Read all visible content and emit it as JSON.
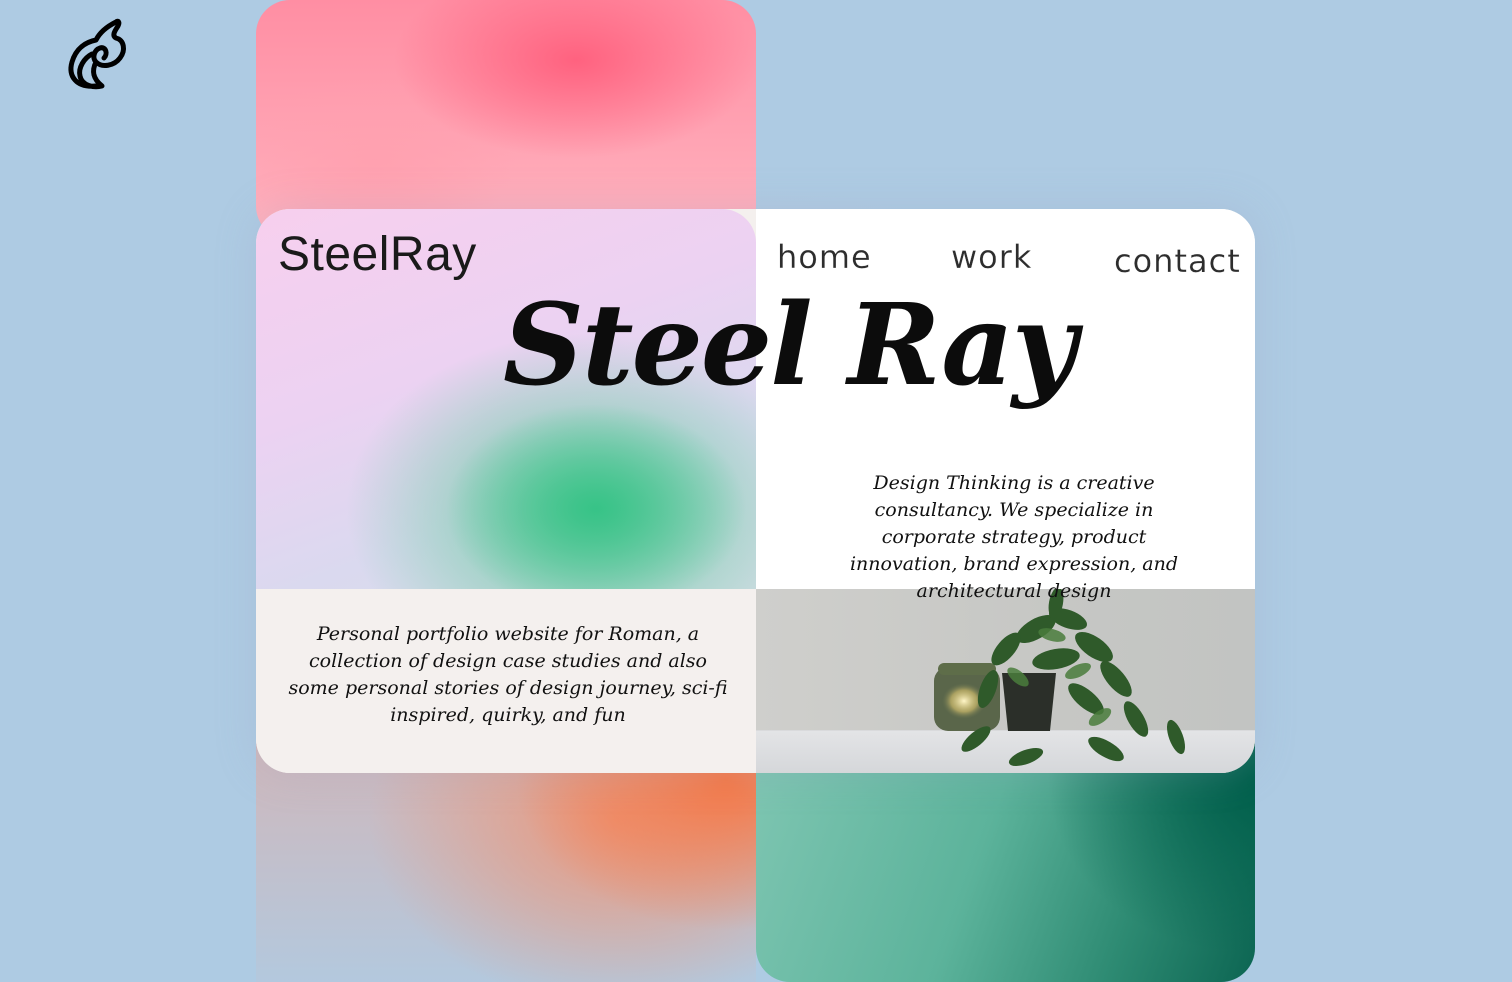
{
  "brand": {
    "logo_icon": "horse-head-script-icon",
    "name": "SteelRay"
  },
  "nav": {
    "items": [
      {
        "label": "home"
      },
      {
        "label": "work"
      },
      {
        "label": "contact"
      }
    ]
  },
  "hero": {
    "title": "Steel Ray",
    "tagline": "Design Thinking is a creative consultancy. We specialize in corporate strategy, product innovation, brand expression, and architectural design"
  },
  "portfolio": {
    "description": "Personal portfolio website for Roman, a collection of design case studies and also some personal stories of design journey, sci-fi inspired, quirky, and fun"
  },
  "media": {
    "photo": "potted-plant-and-candle-photo"
  },
  "colors": {
    "background": "#aecbe3",
    "pink": "#ff8ea3",
    "green_blob": "#37c387",
    "orange": "#f67846",
    "teal": "#0c6552",
    "card": "#f4f0ee",
    "text": "#0c0c0c"
  }
}
